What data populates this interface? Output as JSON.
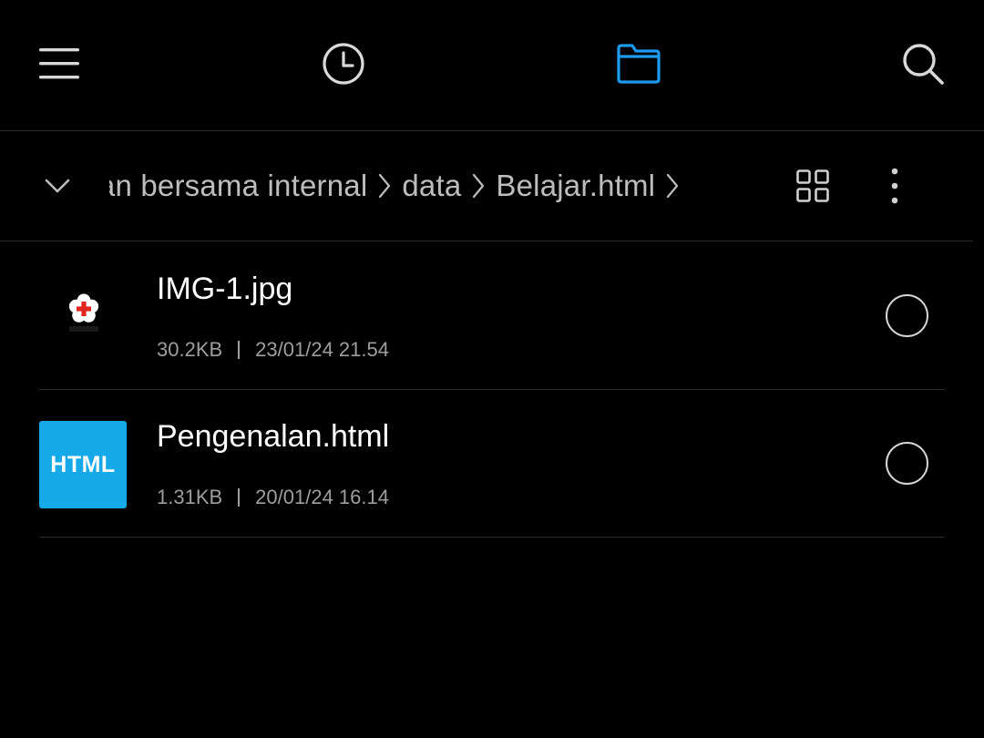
{
  "toolbar": {
    "menu_icon": "hamburger-menu-icon",
    "recent_icon": "clock-icon",
    "files_icon": "folder-icon",
    "search_icon": "search-icon",
    "active_color": "#1e9bf0"
  },
  "path_bar": {
    "crumbs": [
      "Penyimpanan bersama internal",
      "data",
      "Belajar.html"
    ],
    "toggle_icon": "chevron-down-icon",
    "view_icon": "grid-view-icon",
    "more_icon": "more-vertical-icon"
  },
  "files": [
    {
      "name": "IMG-1.jpg",
      "size": "30.2KB",
      "date": "23/01/24 21.54",
      "thumb_type": "image",
      "thumb_icon": "flower-cross-logo-icon"
    },
    {
      "name": "Pengenalan.html",
      "size": "1.31KB",
      "date": "20/01/24 16.14",
      "thumb_type": "html",
      "thumb_label": "HTML",
      "thumb_color": "#16a9ea"
    }
  ]
}
